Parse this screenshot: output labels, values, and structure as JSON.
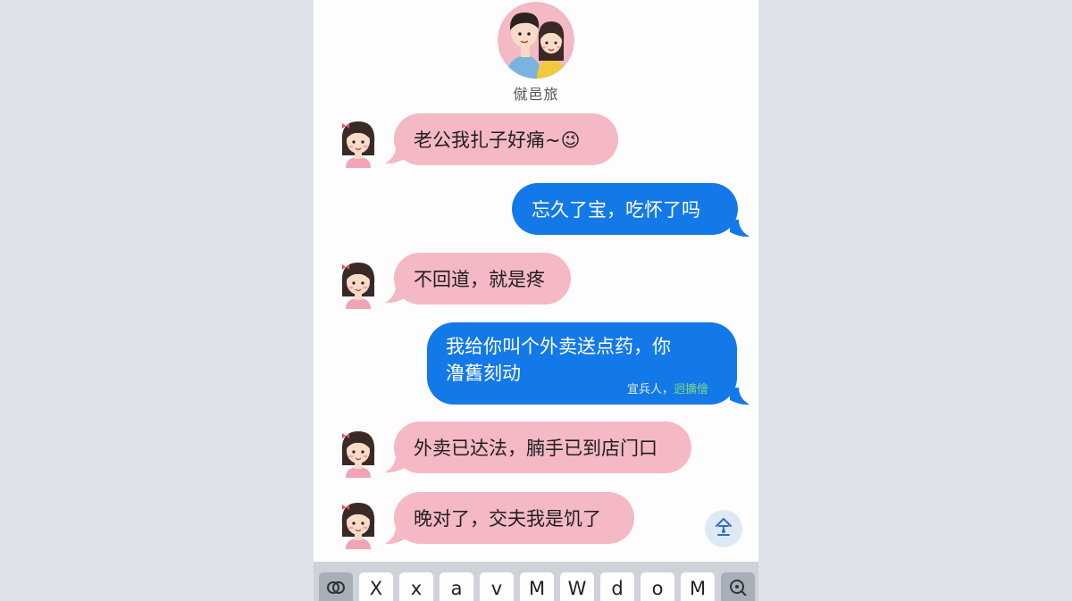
{
  "contact": {
    "name": "僦邑旅"
  },
  "messages": [
    {
      "side": "in",
      "text": "老公我扎子好痛~😉"
    },
    {
      "side": "out",
      "text": "忘久了宝，吃怀了吗"
    },
    {
      "side": "in",
      "text": "不回道，就是疼"
    },
    {
      "side": "out",
      "line1": "我给你叫个外卖送点药，你",
      "line2": "澛舊刻动",
      "sub_left": "宜兵人，",
      "sub_right": "迥擴儈"
    },
    {
      "side": "in",
      "text": "外卖已达法，腩手已到店门口"
    },
    {
      "side": "in",
      "text": "晚对了，交夫我是饥了"
    }
  ],
  "keyboard": {
    "keys": [
      "",
      "X",
      "x",
      "a",
      "v",
      "M",
      "W",
      "d",
      "o",
      "M",
      ""
    ]
  },
  "colors": {
    "incoming_bubble": "#f5b8c5",
    "outgoing_bubble": "#1479e8",
    "keyboard_bg": "#cfd3d9"
  },
  "icons": {
    "float_button": "share-icon",
    "key_first": "link-icon",
    "key_last": "search-icon"
  }
}
